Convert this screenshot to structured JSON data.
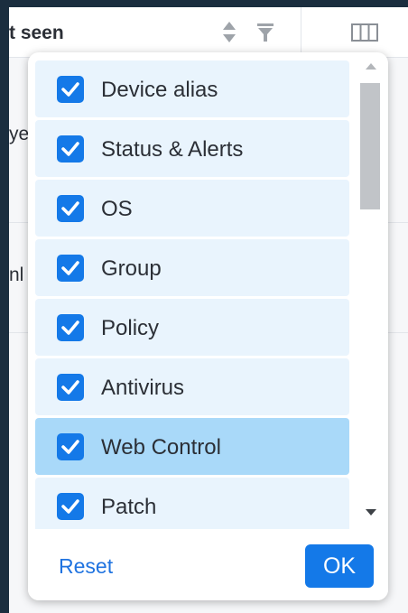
{
  "table_header": {
    "column_title": "t seen",
    "sort_icon": "sort-updown-icon",
    "filter_icon": "filter-icon",
    "columns_icon": "columns-chooser-icon"
  },
  "background_rows": [
    {
      "text": "ye"
    },
    {
      "text": "nl"
    }
  ],
  "column_chooser": {
    "items": [
      {
        "label": "Device alias",
        "checked": true
      },
      {
        "label": "Status & Alerts",
        "checked": true
      },
      {
        "label": "OS",
        "checked": true
      },
      {
        "label": "Group",
        "checked": true
      },
      {
        "label": "Policy",
        "checked": true
      },
      {
        "label": "Antivirus",
        "checked": true
      },
      {
        "label": "Web Control",
        "checked": true,
        "highlighted": true
      },
      {
        "label": "Patch",
        "checked": true
      }
    ],
    "reset_label": "Reset",
    "ok_label": "OK"
  },
  "colors": {
    "accent": "#1479e8",
    "item_bg": "#e9f4fd",
    "item_active_bg": "#a9d9f9",
    "page_bg": "#1b2e3f"
  }
}
